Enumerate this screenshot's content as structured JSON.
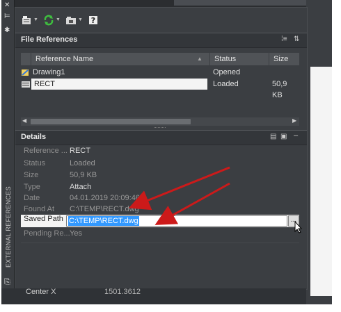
{
  "sidebar": {
    "close_glyph": "✕",
    "pin_glyph": "⊨",
    "settings_glyph": "✱",
    "vertical_label": "EXTERNAL REFERENCES"
  },
  "toolbar": {
    "attach_icon": "attach-dwg-icon",
    "refresh_icon": "refresh-icon",
    "change_path_icon": "change-path-icon",
    "help_icon": "help-icon",
    "help_glyph": "?"
  },
  "file_references": {
    "title": "File References",
    "columns": {
      "name": "Reference Name",
      "status": "Status",
      "size": "Size"
    },
    "rows": [
      {
        "name": "Drawing1",
        "status": "Opened",
        "size": ""
      },
      {
        "name": "RECT",
        "status": "Loaded",
        "size": "50,9 KB"
      }
    ]
  },
  "details": {
    "title": "Details",
    "rows": [
      {
        "label": "Reference ...",
        "value": "RECT"
      },
      {
        "label": "Status",
        "value": "Loaded"
      },
      {
        "label": "Size",
        "value": "50,9 KB"
      },
      {
        "label": "Type",
        "value": "Attach"
      },
      {
        "label": "Date",
        "value": "04.01.2019 20:09:46"
      },
      {
        "label": "Found At",
        "value": "C:\\TEMP\\RECT.dwg"
      }
    ],
    "saved_path": {
      "label": "Saved Path",
      "value": "C:\\TEMP\\RECT.dwg",
      "browse": "..."
    },
    "pending": {
      "label": "Pending Re...",
      "value": "Yes"
    }
  },
  "background": {
    "property_label": "Center X",
    "property_value": "1501.3612"
  },
  "colors": {
    "panel_bg": "#3b3e42",
    "selection_bg": "#3399ff",
    "arrow_red": "#cc1a1a"
  }
}
